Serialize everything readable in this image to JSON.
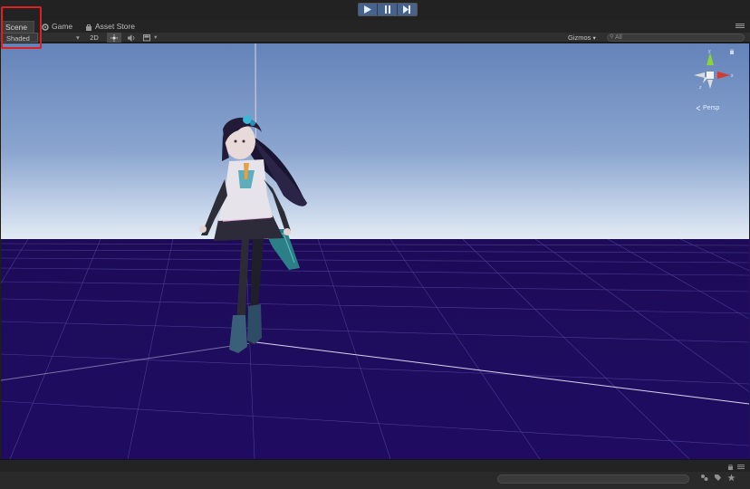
{
  "playbar": {
    "buttons": [
      {
        "name": "play",
        "icon": "play-icon",
        "active": true
      },
      {
        "name": "pause",
        "icon": "pause-icon",
        "active": false
      },
      {
        "name": "step",
        "icon": "step-icon",
        "active": false
      }
    ],
    "accent": "#46638e"
  },
  "tabs": {
    "scene": "Scene",
    "game": "Game",
    "asset_store": "Asset Store",
    "active": "scene"
  },
  "toolbar": {
    "shading_mode": "Shaded",
    "mode_2d": "2D",
    "gizmos": "Gizmos",
    "search_placeholder": "All"
  },
  "viewport": {
    "sky_top": "#6a8cc4",
    "sky_bottom": "#d9e4f0",
    "ground": "#1e0a5c",
    "grid": "#6d5fb5"
  },
  "gizmo": {
    "projection": "Persp",
    "axis_colors": {
      "y": "#8ad33a",
      "x": "#d23b2e",
      "z": "#e8e8e8"
    }
  },
  "highlight_color": "#e02020"
}
